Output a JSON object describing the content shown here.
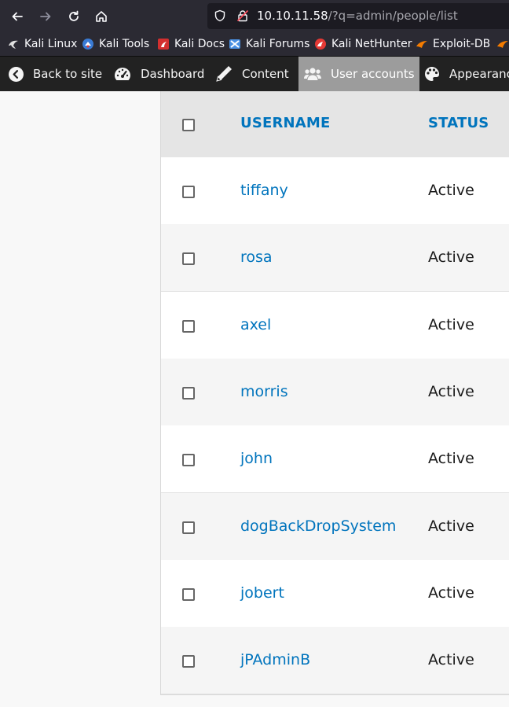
{
  "browser": {
    "url_host": "10.10.11.58",
    "url_path": "/?q=admin/people/list",
    "bookmarks": [
      {
        "label": "Kali Linux",
        "icon": "kali-dragon-icon",
        "color": "#e0e0e0"
      },
      {
        "label": "Kali Tools",
        "icon": "kali-tools-icon",
        "color": "#3a7bd5"
      },
      {
        "label": "Kali Docs",
        "icon": "kali-docs-icon",
        "color": "#d32f2f"
      },
      {
        "label": "Kali Forums",
        "icon": "kali-forums-icon",
        "color": "#4a90e2"
      },
      {
        "label": "Kali NetHunter",
        "icon": "kali-nethunter-icon",
        "color": "#e53935"
      },
      {
        "label": "Exploit-DB",
        "icon": "exploit-db-icon",
        "color": "#f57c00"
      }
    ]
  },
  "adminbar": {
    "items": [
      {
        "label": "Back to site",
        "icon": "back-arrow-icon"
      },
      {
        "label": "Dashboard",
        "icon": "dashboard-gauge-icon"
      },
      {
        "label": "Content",
        "icon": "pencil-icon"
      },
      {
        "label": "User accounts",
        "icon": "users-icon",
        "active": true
      },
      {
        "label": "Appearance",
        "icon": "palette-icon"
      }
    ]
  },
  "table": {
    "headers": {
      "username": "USERNAME",
      "status": "STATUS"
    },
    "rows": [
      {
        "username": "tiffany",
        "status": "Active"
      },
      {
        "username": "rosa",
        "status": "Active"
      },
      {
        "username": "axel",
        "status": "Active"
      },
      {
        "username": "morris",
        "status": "Active"
      },
      {
        "username": "john",
        "status": "Active"
      },
      {
        "username": "dogBackDropSystem",
        "status": "Active"
      },
      {
        "username": "jobert",
        "status": "Active"
      },
      {
        "username": "jPAdminB",
        "status": "Active"
      }
    ]
  },
  "colors": {
    "link": "#0074bd",
    "adminbar_bg": "#222222",
    "active_tab": "#9c9c9c"
  }
}
